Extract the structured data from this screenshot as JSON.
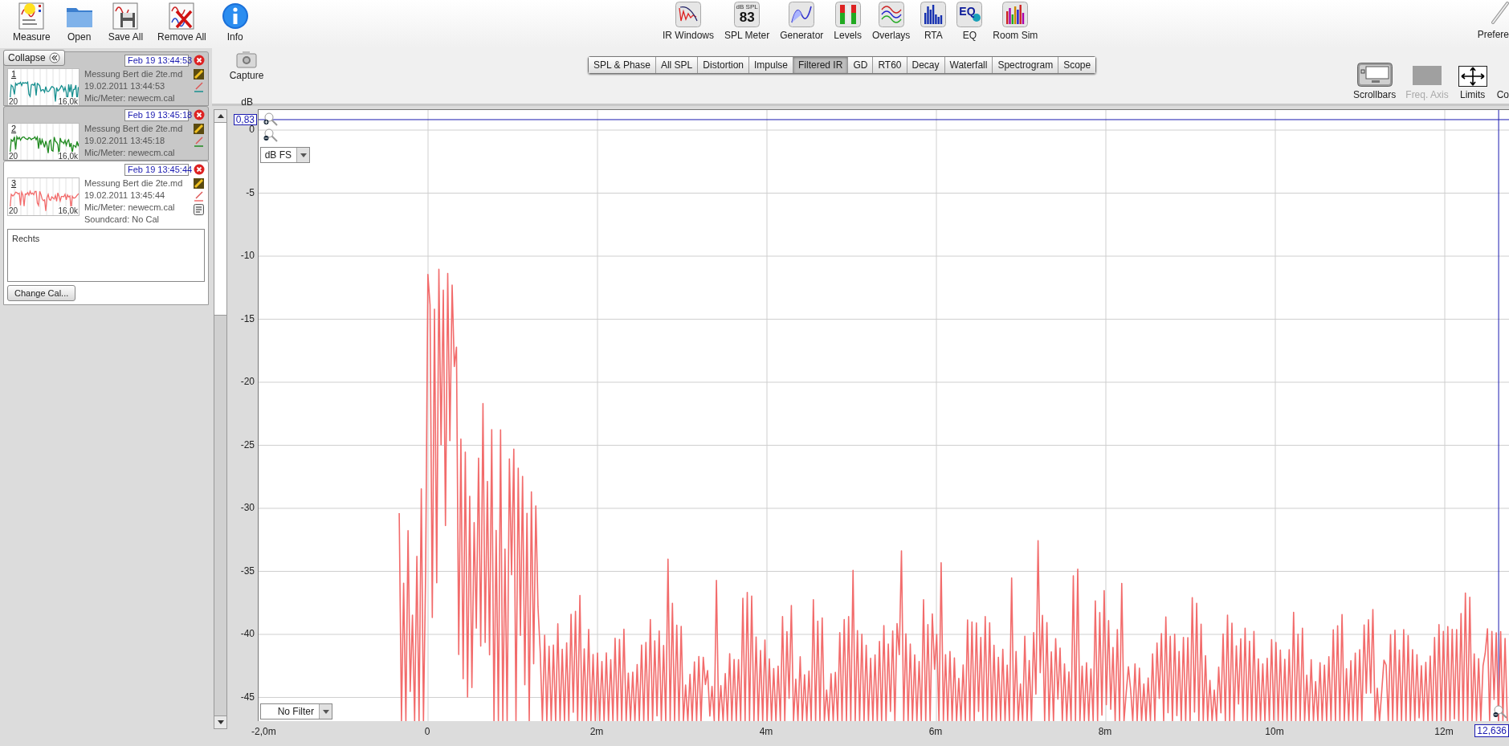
{
  "toolbar": [
    {
      "label": "Measure"
    },
    {
      "label": "Open"
    },
    {
      "label": "Save All"
    },
    {
      "label": "Remove All"
    },
    {
      "label": "Info"
    }
  ],
  "tools": [
    {
      "kind": "ir_windows",
      "label": "IR Windows"
    },
    {
      "kind": "spl_meter",
      "label": "SPL Meter",
      "unit": "dB SPL",
      "reading": "83"
    },
    {
      "kind": "generator",
      "label": "Generator"
    },
    {
      "kind": "levels",
      "label": "Levels"
    },
    {
      "kind": "overlays",
      "label": "Overlays"
    },
    {
      "kind": "rta",
      "label": "RTA"
    },
    {
      "kind": "eq",
      "label": "EQ",
      "icon_text": "EQ"
    },
    {
      "kind": "room_sim",
      "label": "Room Sim"
    }
  ],
  "preferences": {
    "label": "Prefere"
  },
  "capture": {
    "label": "Capture"
  },
  "tabs": [
    {
      "label": "SPL & Phase",
      "selected": false
    },
    {
      "label": "All SPL",
      "selected": false
    },
    {
      "label": "Distortion",
      "selected": false
    },
    {
      "label": "Impulse",
      "selected": false
    },
    {
      "label": "Filtered IR",
      "selected": true
    },
    {
      "label": "GD",
      "selected": false
    },
    {
      "label": "RT60",
      "selected": false
    },
    {
      "label": "Decay",
      "selected": false
    },
    {
      "label": "Waterfall",
      "selected": false
    },
    {
      "label": "Spectrogram",
      "selected": false
    },
    {
      "label": "Scope",
      "selected": false
    }
  ],
  "view_tools": [
    {
      "kind": "scrollbars",
      "label": "Scrollbars",
      "on": true
    },
    {
      "kind": "freq_axis",
      "label": "Freq. Axis",
      "disabled": true
    },
    {
      "kind": "limits",
      "label": "Limits"
    },
    {
      "kind": "cut",
      "label": "Co"
    }
  ],
  "collapse_button": {
    "label": "Collapse"
  },
  "measurements": [
    {
      "number": "1",
      "timestamp": "Feb 19 13:44:53",
      "name": "Messung Bert die 2te.md",
      "date": "19.02.2011 13:44:53",
      "mic": "Mic/Meter: newecm.cal",
      "axis_min": "20",
      "axis_max": "16,0k",
      "color": "#178f8f",
      "selected": false
    },
    {
      "number": "2",
      "timestamp": "Feb 19 13:45:18",
      "name": "Messung Bert die 2te.md",
      "date": "19.02.2011 13:45:18",
      "mic": "Mic/Meter: newecm.cal",
      "axis_min": "20",
      "axis_max": "16,0k",
      "color": "#1f8a1f",
      "selected": false
    },
    {
      "number": "3",
      "timestamp": "Feb 19 13:45:44",
      "name": "Messung Bert die 2te.md",
      "date": "19.02.2011 13:45:44",
      "mic": "Mic/Meter: newecm.cal",
      "soundcard": "Soundcard: No Cal",
      "notes": "Rechts",
      "axis_min": "20",
      "axis_max": "16,0k",
      "color": "#f26b6b",
      "selected": true
    }
  ],
  "change_cal_button": "Change Cal...",
  "plot": {
    "y_unit": "dB",
    "y_cursor": "0,83",
    "x_cursor": "12,636",
    "scale_dropdown": "dB FS",
    "filter_dropdown": "No Filter",
    "yticks": [
      "0",
      "-5",
      "-10",
      "-15",
      "-20",
      "-25",
      "-30",
      "-35",
      "-40",
      "-45"
    ],
    "xticks": [
      "-2,0m",
      "0",
      "2m",
      "4m",
      "6m",
      "8m",
      "10m",
      "12m"
    ]
  }
}
